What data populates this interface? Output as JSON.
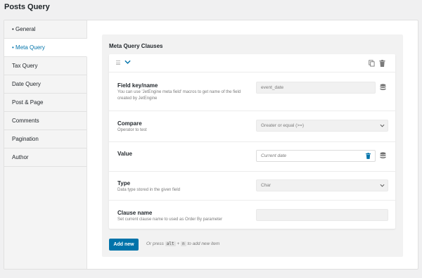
{
  "page": {
    "title": "Posts Query"
  },
  "sidebar": {
    "items": [
      {
        "label": "• General"
      },
      {
        "label": "• Meta Query",
        "active": true
      },
      {
        "label": "Tax Query"
      },
      {
        "label": "Date Query"
      },
      {
        "label": "Post & Page"
      },
      {
        "label": "Comments"
      },
      {
        "label": "Pagination"
      },
      {
        "label": "Author"
      }
    ]
  },
  "meta_query": {
    "title": "Meta Query Clauses",
    "header_icons": [
      "drag-handle-icon",
      "chevron-down-icon",
      "copy-icon",
      "trash-icon"
    ],
    "fields": {
      "field_key": {
        "label": "Field key/name",
        "description": "You can use 'JetEngine meta field' macros to get name of the field created by JetEngine",
        "value": "event_date"
      },
      "compare": {
        "label": "Compare",
        "description": "Operator to test",
        "selected": "Greater or equal (>=)"
      },
      "value": {
        "label": "Value",
        "value": "Current date"
      },
      "type": {
        "label": "Type",
        "description": "Data type stored in the given field",
        "selected": "Char"
      },
      "clause_name": {
        "label": "Clause name",
        "description": "Set current clause name to used as Order By parameter",
        "value": ""
      }
    },
    "add_button": "Add new",
    "hint": {
      "prefix": "Or press",
      "key1": "alt",
      "plus": "+",
      "key2": "n",
      "suffix": "to add new item"
    }
  },
  "colors": {
    "accent": "#0073aa",
    "background": "#f0f0f1"
  }
}
